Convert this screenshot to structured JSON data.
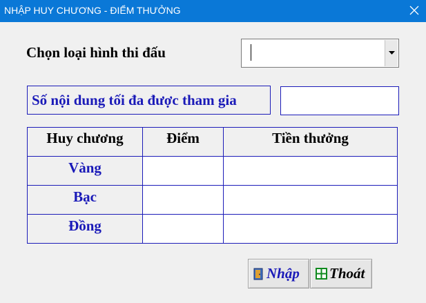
{
  "window": {
    "title": "NHẬP HUY CHƯƠNG - ĐIỂM THƯỞNG",
    "close_icon": "close-icon"
  },
  "form": {
    "competition_type_label": "Chọn loại hình thi đấu",
    "competition_type_value": "",
    "max_events_label": "Số nội dung tối đa được tham gia",
    "max_events_value": ""
  },
  "medal_table": {
    "headers": [
      "Huy chương",
      "Điểm",
      "Tiền thưởng"
    ],
    "rows": [
      {
        "medal": "Vàng",
        "points": "",
        "reward": ""
      },
      {
        "medal": "Bạc",
        "points": "",
        "reward": ""
      },
      {
        "medal": "Đồng",
        "points": "",
        "reward": ""
      }
    ]
  },
  "buttons": {
    "submit_label": "Nhập",
    "submit_icon": "door-enter-icon",
    "exit_label": "Thoát",
    "exit_icon": "grid-exit-icon"
  },
  "colors": {
    "titlebar": "#0a78d7",
    "accent_blue": "#1a1ab8",
    "exit_icon_green": "#0f8a1e"
  }
}
